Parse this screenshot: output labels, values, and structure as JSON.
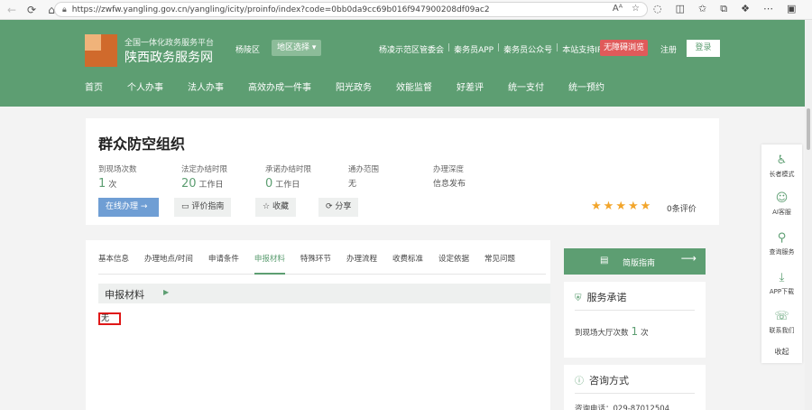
{
  "browser": {
    "url": "https://zwfw.yangling.gov.cn/yangling/icity/proinfo/index?code=0bb0da9cc69b016f947900208df09ac2",
    "read_aloud": "Aᴬ"
  },
  "header": {
    "logo_sub": "全国一体化政务服务平台",
    "logo_main": "陕西政务服务网",
    "region": "杨陵区",
    "region_select": "地区选择 ▾",
    "links": [
      "杨凌示范区管委会",
      "秦务员APP",
      "秦务员公众号",
      "本站支持IPv6"
    ],
    "accessibility": "无障碍浏览",
    "register": "注册",
    "login": "登录",
    "nav": [
      "首页",
      "个人办事",
      "法人办事",
      "高效办成一件事",
      "阳光政务",
      "效能监督",
      "好差评",
      "统一支付",
      "统一预约"
    ]
  },
  "service": {
    "title": "群众防空组织",
    "stats": [
      {
        "label": "到现场次数",
        "num": "1",
        "unit": "次"
      },
      {
        "label": "法定办结时限",
        "num": "20",
        "unit": "工作日"
      },
      {
        "label": "承诺办结时限",
        "num": "0",
        "unit": "工作日"
      },
      {
        "label": "通办范围",
        "num": "",
        "unit": "无"
      },
      {
        "label": "办理深度",
        "num": "",
        "unit": "信息发布"
      }
    ],
    "btn_online": "在线办理",
    "btn_guide": "评价指南",
    "btn_fav": "收藏",
    "btn_share": "分享",
    "rating": 5,
    "rating_text": "0条评价"
  },
  "tabs": [
    "基本信息",
    "办理地点/时间",
    "申请条件",
    "申报材料",
    "特殊环节",
    "办理流程",
    "收费标准",
    "设定依据",
    "常见问题"
  ],
  "active_tab": 3,
  "section": {
    "title": "申报材料",
    "content": "无"
  },
  "sidebar": {
    "guide_label": "简版指南",
    "promise_title": "服务承诺",
    "promise_row_label": "到现场大厅次数",
    "promise_row_num": "1",
    "promise_row_unit": "次",
    "contact_title": "咨询方式",
    "contact_row": "咨询电话：029-87012504"
  },
  "float_toolbar": {
    "items": [
      "长者模式",
      "AI客服",
      "查询服务",
      "APP下载",
      "联系我们"
    ],
    "collapse": "收起"
  },
  "colors": {
    "brand_green": "#5d9e72",
    "accent_blue": "#6f9ed4",
    "star": "#f2a52b",
    "highlight_red": "#e01818"
  }
}
